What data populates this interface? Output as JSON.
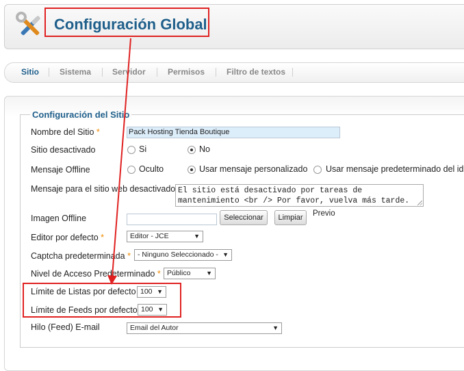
{
  "header": {
    "title": "Configuración Global",
    "icon": "tools-icon"
  },
  "tabs": [
    {
      "label": "Sitio",
      "active": true
    },
    {
      "label": "Sistema"
    },
    {
      "label": "Servidor"
    },
    {
      "label": "Permisos"
    },
    {
      "label": "Filtro de textos"
    }
  ],
  "section": {
    "legend": "Configuración del Sitio"
  },
  "fields": {
    "site_name": {
      "label": "Nombre del Sitio",
      "required": "*",
      "value": "Pack Hosting Tienda Boutique"
    },
    "site_offline": {
      "label": "Sitio desactivado",
      "options": [
        "Si",
        "No"
      ],
      "selected": "No"
    },
    "offline_message": {
      "label": "Mensaje Offline",
      "options": [
        "Oculto",
        "Usar mensaje personalizado",
        "Usar mensaje predeterminado del idi"
      ],
      "selected": "Usar mensaje personalizado"
    },
    "offline_text": {
      "label": "Mensaje para el sitio web desactivado",
      "lines": [
        "El sitio está desactivado por tareas de",
        "mantenimiento <br /> Por favor, vuelva más tarde."
      ]
    },
    "offline_image": {
      "label": "Imagen Offline",
      "value": "",
      "select_button": "Seleccionar",
      "clear_button": "Limpiar",
      "preview_label": "Previo"
    },
    "default_editor": {
      "label": "Editor por defecto",
      "required": "*",
      "value": "Editor - JCE"
    },
    "default_captcha": {
      "label": "Captcha predeterminada",
      "required": "*",
      "value": "- Ninguno Seleccionado -"
    },
    "default_access": {
      "label": "Nivel de Acceso Predeterminado",
      "required": "*",
      "value": "Público"
    },
    "list_limit": {
      "label": "Límite de Listas por defecto",
      "value": "100"
    },
    "feed_limit": {
      "label": "Límite de Feeds por defecto",
      "value": "100"
    },
    "feed_email": {
      "label": "Hilo (Feed) E-mail",
      "value": "Email del Autor"
    }
  },
  "dropdown_arrow": "▼",
  "colors": {
    "accent": "#1f5f8b",
    "annotation": "#e02020",
    "required": "#f08a00"
  }
}
